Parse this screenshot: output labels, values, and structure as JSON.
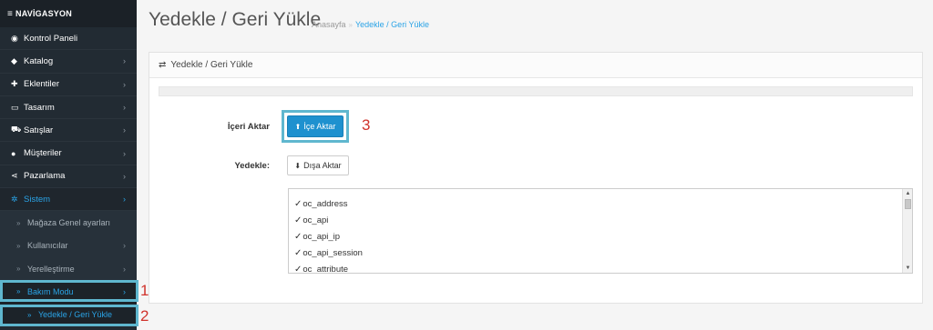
{
  "sidebar": {
    "header": "NAVİGASYON",
    "items": [
      {
        "label": "Kontrol Paneli",
        "icon": "dashboard-icon",
        "glyph": "◉",
        "chev": ""
      },
      {
        "label": "Katalog",
        "icon": "tag-icon",
        "glyph": "◆",
        "chev": "›"
      },
      {
        "label": "Eklentiler",
        "icon": "puzzle-icon",
        "glyph": "✚",
        "chev": "›"
      },
      {
        "label": "Tasarım",
        "icon": "monitor-icon",
        "glyph": "▭",
        "chev": "›"
      },
      {
        "label": "Satışlar",
        "icon": "cart-icon",
        "glyph": "⛟",
        "chev": "›"
      },
      {
        "label": "Müşteriler",
        "icon": "user-icon",
        "glyph": "●",
        "chev": "›"
      },
      {
        "label": "Pazarlama",
        "icon": "share-icon",
        "glyph": "⋖",
        "chev": "›"
      },
      {
        "label": "Sistem",
        "icon": "gear-icon",
        "glyph": "✲",
        "chev": "›"
      }
    ],
    "sub_items": [
      {
        "label": "Mağaza Genel ayarları",
        "chev": ""
      },
      {
        "label": "Kullanıcılar",
        "chev": "›"
      },
      {
        "label": "Yerelleştirme",
        "chev": "›"
      },
      {
        "label": "Bakım Modu",
        "chev": "›"
      }
    ],
    "sub_sub_item": {
      "label": "Yedekle / Geri Yükle"
    }
  },
  "header": {
    "title": "Yedekle / Geri Yükle",
    "breadcrumb_home": "Anasayfa",
    "breadcrumb_sep": "»",
    "breadcrumb_current": "Yedekle / Geri Yükle"
  },
  "panel": {
    "title": "Yedekle / Geri Yükle",
    "import_label": "İçeri Aktar",
    "import_button": "İçe Aktar",
    "backup_label": "Yedekle:",
    "export_button": "Dışa Aktar",
    "tables": [
      "oc_address",
      "oc_api",
      "oc_api_ip",
      "oc_api_session",
      "oc_attribute"
    ]
  },
  "annotations": {
    "one": "1",
    "two": "2",
    "three": "3",
    "color": "#d0332c"
  },
  "colors": {
    "accent": "#1e91cf",
    "sidebar_bg": "#222b33",
    "highlight": "#5fb7cf"
  }
}
